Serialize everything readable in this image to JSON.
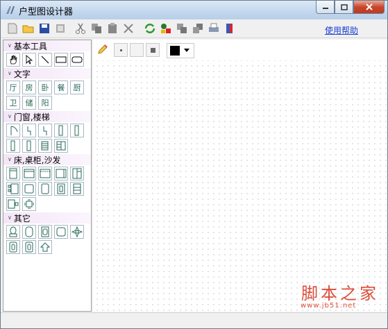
{
  "window": {
    "title": "户型图设计器"
  },
  "toolbar": {
    "help_label": "使用帮助"
  },
  "panel": {
    "sections": [
      {
        "title": "基本工具",
        "items": [
          "hand",
          "pointer",
          "line",
          "rectangle",
          "rounded-rectangle"
        ]
      },
      {
        "title": "文字",
        "items": [
          "厅",
          "房",
          "卧",
          "餐",
          "厨",
          "卫",
          "储",
          "阳"
        ]
      },
      {
        "title": "门窗,楼梯",
        "items": [
          "door-swing",
          "door-left",
          "door-right",
          "window-v1",
          "window-v2",
          "window-v3",
          "window-v4",
          "stairs",
          "stairs-2"
        ]
      },
      {
        "title": "床,桌柜,沙发",
        "items": [
          "bed-1",
          "bed-2",
          "bed-3",
          "sofa-1",
          "cabinet-1",
          "table-1",
          "rect-1",
          "rect-2",
          "chair-1",
          "chair-2",
          "table-2",
          "table-3"
        ]
      },
      {
        "title": "其它",
        "items": [
          "toilet",
          "bathtub",
          "sink",
          "basin",
          "plant",
          "item-1",
          "item-2",
          "arrow-up"
        ]
      }
    ]
  },
  "canvas_toolbar": {
    "color": "#000000"
  },
  "watermark": {
    "text": "脚本之家",
    "url": "www.jb51.net"
  }
}
